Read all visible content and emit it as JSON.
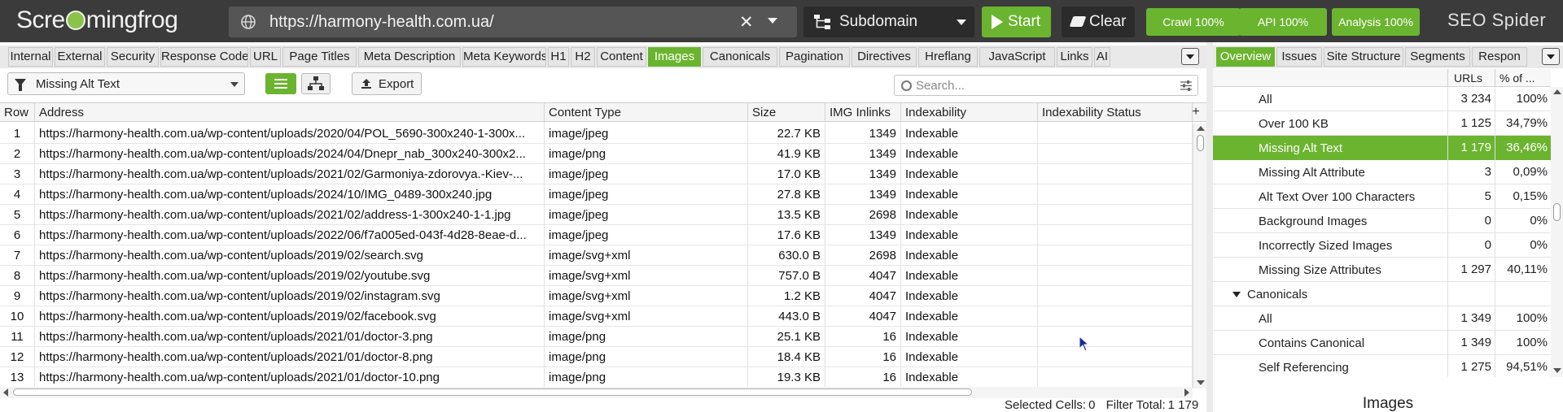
{
  "topbar": {
    "logo_left": "Scre",
    "logo_right": "mingfrog",
    "url": "https://harmony-health.com.ua/",
    "mode": "Subdomain",
    "start_label": "Start",
    "clear_label": "Clear",
    "crawl": "Crawl 100%",
    "api": "API 100%",
    "analysis": "Analysis 100%",
    "brand": "SEO Spider"
  },
  "tabs": [
    "Internal",
    "External",
    "Security",
    "Response Codes",
    "URL",
    "Page Titles",
    "Meta Description",
    "Meta Keywords",
    "H1",
    "H2",
    "Content",
    "Images",
    "Canonicals",
    "Pagination",
    "Directives",
    "Hreflang",
    "JavaScript",
    "Links",
    "AI"
  ],
  "active_tab": "Images",
  "toolbar": {
    "filter": "Missing Alt Text",
    "export_label": "Export",
    "search_placeholder": "Search..."
  },
  "table": {
    "columns": [
      "Row",
      "Address",
      "Content Type",
      "Size",
      "IMG Inlinks",
      "Indexability",
      "Indexability Status"
    ],
    "rows": [
      [
        "1",
        "https://harmony-health.com.ua/wp-content/uploads/2020/04/POL_5690-300x240-1-300x...",
        "image/jpeg",
        "22.7 KB",
        "1349",
        "Indexable",
        ""
      ],
      [
        "2",
        "https://harmony-health.com.ua/wp-content/uploads/2024/04/Dnepr_nab_300x240-300x2...",
        "image/png",
        "41.9 KB",
        "1349",
        "Indexable",
        ""
      ],
      [
        "3",
        "https://harmony-health.com.ua/wp-content/uploads/2021/02/Garmoniya-zdorovya.-Kiev-...",
        "image/jpeg",
        "17.0 KB",
        "1349",
        "Indexable",
        ""
      ],
      [
        "4",
        "https://harmony-health.com.ua/wp-content/uploads/2024/10/IMG_0489-300x240.jpg",
        "image/jpeg",
        "27.8 KB",
        "1349",
        "Indexable",
        ""
      ],
      [
        "5",
        "https://harmony-health.com.ua/wp-content/uploads/2021/02/address-1-300x240-1-1.jpg",
        "image/jpeg",
        "13.5 KB",
        "2698",
        "Indexable",
        ""
      ],
      [
        "6",
        "https://harmony-health.com.ua/wp-content/uploads/2022/06/f7a005ed-043f-4d28-8eae-d...",
        "image/jpeg",
        "17.6 KB",
        "1349",
        "Indexable",
        ""
      ],
      [
        "7",
        "https://harmony-health.com.ua/wp-content/uploads/2019/02/search.svg",
        "image/svg+xml",
        "630.0 B",
        "2698",
        "Indexable",
        ""
      ],
      [
        "8",
        "https://harmony-health.com.ua/wp-content/uploads/2019/02/youtube.svg",
        "image/svg+xml",
        "757.0 B",
        "4047",
        "Indexable",
        ""
      ],
      [
        "9",
        "https://harmony-health.com.ua/wp-content/uploads/2019/02/instagram.svg",
        "image/svg+xml",
        "1.2 KB",
        "4047",
        "Indexable",
        ""
      ],
      [
        "10",
        "https://harmony-health.com.ua/wp-content/uploads/2019/02/facebook.svg",
        "image/svg+xml",
        "443.0 B",
        "4047",
        "Indexable",
        ""
      ],
      [
        "11",
        "https://harmony-health.com.ua/wp-content/uploads/2021/01/doctor-3.png",
        "image/png",
        "25.1 KB",
        "16",
        "Indexable",
        ""
      ],
      [
        "12",
        "https://harmony-health.com.ua/wp-content/uploads/2021/01/doctor-8.png",
        "image/png",
        "18.4 KB",
        "16",
        "Indexable",
        ""
      ],
      [
        "13",
        "https://harmony-health.com.ua/wp-content/uploads/2021/01/doctor-10.png",
        "image/png",
        "19.3 KB",
        "16",
        "Indexable",
        ""
      ]
    ]
  },
  "status": {
    "selected_label": "Selected Cells:",
    "selected_value": "0",
    "filter_label": "Filter Total:",
    "filter_value": "1 179"
  },
  "right_panel": {
    "tabs": [
      "Overview",
      "Issues",
      "Site Structure",
      "Segments",
      "Respon"
    ],
    "active_tab": "Overview",
    "col_urls": "URLs",
    "col_pct": "% of ...",
    "rows": [
      {
        "label": "All",
        "urls": "3 234",
        "pct": "100%",
        "kind": "item"
      },
      {
        "label": "Over 100 KB",
        "urls": "1 125",
        "pct": "34,79%",
        "kind": "item"
      },
      {
        "label": "Missing Alt Text",
        "urls": "1 179",
        "pct": "36,46%",
        "kind": "selected"
      },
      {
        "label": "Missing Alt Attribute",
        "urls": "3",
        "pct": "0,09%",
        "kind": "item"
      },
      {
        "label": "Alt Text Over 100 Characters",
        "urls": "5",
        "pct": "0,15%",
        "kind": "item"
      },
      {
        "label": "Background Images",
        "urls": "0",
        "pct": "0%",
        "kind": "item"
      },
      {
        "label": "Incorrectly Sized Images",
        "urls": "0",
        "pct": "0%",
        "kind": "item"
      },
      {
        "label": "Missing Size Attributes",
        "urls": "1 297",
        "pct": "40,11%",
        "kind": "item"
      },
      {
        "label": "Canonicals",
        "urls": "",
        "pct": "",
        "kind": "group"
      },
      {
        "label": "All",
        "urls": "1 349",
        "pct": "100%",
        "kind": "item"
      },
      {
        "label": "Contains Canonical",
        "urls": "1 349",
        "pct": "100%",
        "kind": "item"
      },
      {
        "label": "Self Referencing",
        "urls": "1 275",
        "pct": "94,51%",
        "kind": "item"
      }
    ],
    "footer_title": "Images"
  },
  "colors": {
    "accent": "#6bb42f",
    "topbar": "#3b3b3b"
  }
}
